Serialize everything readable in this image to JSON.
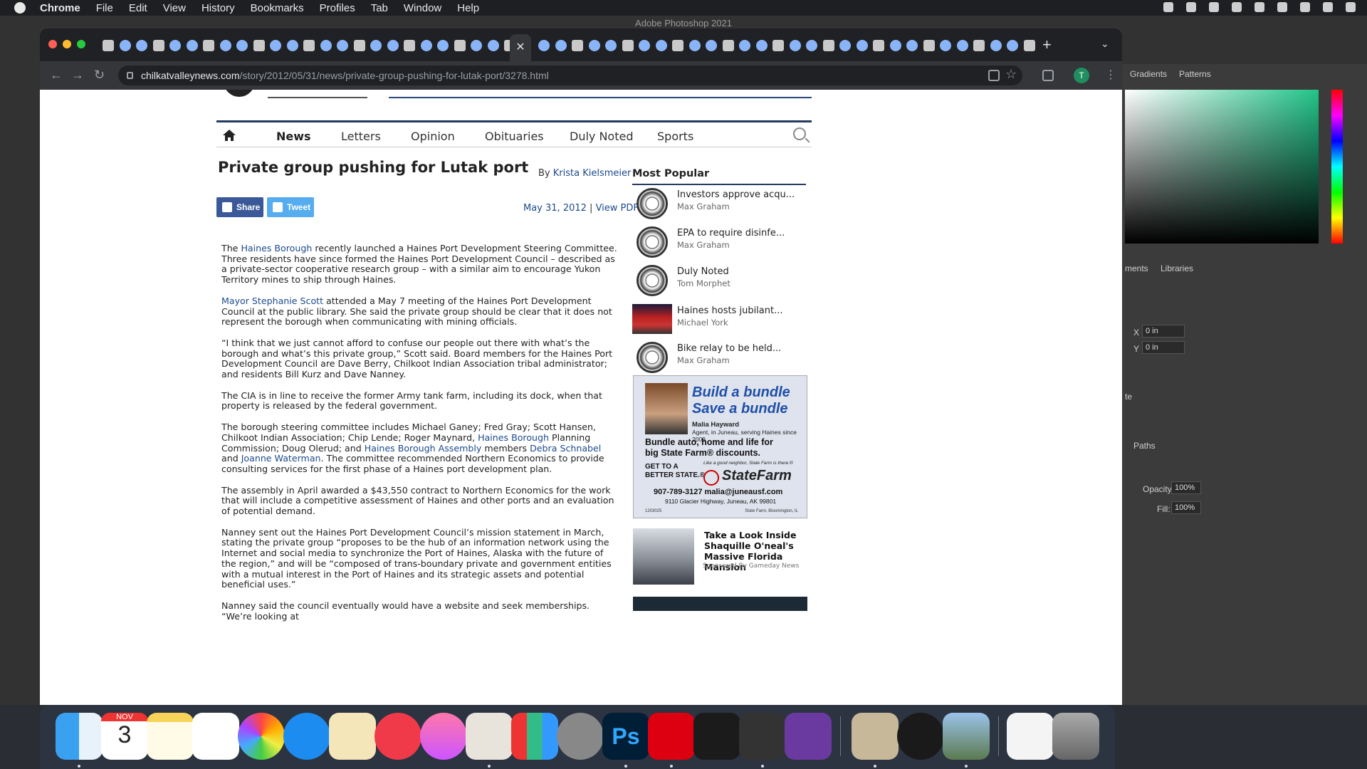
{
  "menubar": {
    "app": "Chrome",
    "items": [
      "File",
      "Edit",
      "View",
      "History",
      "Bookmarks",
      "Profiles",
      "Tab",
      "Window",
      "Help"
    ]
  },
  "photoshop": {
    "title": "Adobe Photoshop 2021",
    "tabs": {
      "gradients": "Gradients",
      "patterns": "Patterns",
      "adjustments": "ments",
      "libraries": "Libraries",
      "paths": "Paths"
    },
    "x_label": "X",
    "x_value": "0 in",
    "y_label": "Y",
    "y_value": "0 in",
    "opacity_label": "Opacity:",
    "opacity_value": "100%",
    "fill_label": "Fill:",
    "fill_value": "100%",
    "te_label": "te"
  },
  "browser": {
    "url_domain": "chilkatvalleynews.com",
    "url_path": "/story/2012/05/31/news/private-group-pushing-for-lutak-port/3278.html",
    "profile_initial": "T",
    "close_tab_glyph": "✕",
    "new_tab_glyph": "+"
  },
  "site_nav": {
    "items": [
      {
        "label": "News",
        "active": true
      },
      {
        "label": "Letters"
      },
      {
        "label": "Opinion"
      },
      {
        "label": "Obituaries"
      },
      {
        "label": "Duly Noted"
      },
      {
        "label": "Sports"
      }
    ]
  },
  "article": {
    "headline": "Private group pushing for Lutak port",
    "byline_prefix": "By",
    "author": "Krista Kielsmeier",
    "date": "May 31, 2012",
    "separator": "|",
    "view_pdf": "View PDF",
    "share_label": "Share",
    "tweet_label": "Tweet",
    "p1": {
      "a": "The ",
      "link": "Haines Borough",
      "b": " recently launched a Haines Port Development Steering Committee. Three residents have since formed the Haines Port Development Council – described as a private-sector cooperative research group – with a similar aim to encourage Yukon Territory mines to ship through Haines."
    },
    "p2": {
      "link": "Mayor Stephanie Scott",
      "b": " attended a May 7 meeting of the Haines Port Development Council at the public library. She said the private group should be clear that it does not represent the borough when communicating with mining officials."
    },
    "p3": "“I think that we just cannot afford to confuse our people out there with what’s the borough and what’s this private group,” Scott said. Board members for the Haines Port Development Council are Dave Berry, Chilkoot Indian Association tribal administrator; and residents Bill Kurz and Dave Nanney.",
    "p4": "The CIA is in line to receive the former Army tank farm, including its dock, when that property is released by the federal government.",
    "p5": {
      "a": "The borough steering committee includes Michael Ganey; Fred Gray; Scott Hansen, Chilkoot Indian Association; Chip Lende; Roger Maynard, ",
      "link1": "Haines Borough",
      "b": " Planning Commission; Doug Olerud; and ",
      "link2": "Haines Borough Assembly",
      "c": " members ",
      "link3": "Debra Schnabel",
      "d": " and ",
      "link4": "Joanne Waterman",
      "e": ". The committee recommended Northern Economics to provide consulting services for the first phase of a Haines port development plan."
    },
    "p6": "The assembly in April awarded a $43,550 contract to Northern Economics for the work that will include a competitive assessment of Haines and other ports and an evaluation of potential demand.",
    "p7": "Nanney sent out the Haines Port Development Council’s mission statement in March, stating the private group “proposes to be the hub of an information network using the Internet and social media to synchronize the Port of Haines, Alaska with the future of the region,” and will be “composed of trans-boundary private and government entities with a mutual interest in the Port of Haines and its strategic assets and potential beneficial uses.”",
    "p8": "Nanney said the council eventually would have a website and seek memberships. “We’re looking at"
  },
  "sidebar": {
    "title": "Most Popular",
    "items": [
      {
        "title": "Investors approve acqu...",
        "author": "Max Graham"
      },
      {
        "title": "EPA to require disinfe...",
        "author": "Max Graham"
      },
      {
        "title": "Duly Noted",
        "author": "Tom Morphet"
      },
      {
        "title": "Haines hosts jubilant...",
        "author": "Michael York"
      },
      {
        "title": "Bike relay to be held...",
        "author": "Max Graham"
      }
    ]
  },
  "ad_statefarm": {
    "headline1": "Build a bundle",
    "headline2": "Save a bundle",
    "agent_name": "Malia Hayward",
    "agent_desc": "Agent, in Juneau, serving Haines since 2009",
    "offer1": "Bundle auto, home and life for",
    "offer2": "big State Farm® discounts.",
    "better1": "GET TO A",
    "better2": "BETTER STATE.®",
    "tagline": "Like a good neighbor, State Farm is there.®",
    "brand": "StateFarm",
    "contact": "907-789-3127   malia@juneausf.com",
    "address": "9110 Glacier Highway, Juneau, AK 99801",
    "code": "1203025",
    "location": "State Farm, Bloomington, IL"
  },
  "sponsored": {
    "title": "Take a Look Inside Shaquille O'neal's Massive Florida Mansion",
    "by": "Sponsored By Gameday News"
  },
  "dock": {
    "calendar_month": "NOV",
    "calendar_day": "3",
    "ps_label": "Ps"
  },
  "colors": {
    "nav_border": "#233a63",
    "link": "#1c4a8c",
    "facebook": "#3b5998",
    "twitter": "#55acee"
  }
}
